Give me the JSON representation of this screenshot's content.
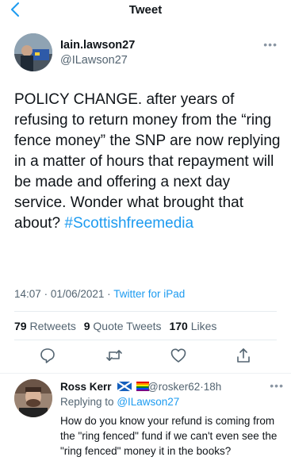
{
  "nav": {
    "title": "Tweet"
  },
  "tweet": {
    "author_name": "Iain.lawson27",
    "author_handle": "@ILawson27",
    "text": "POLICY CHANGE. after years of refusing to return money from the “ring fence money” the SNP are now replying in a matter of hours that repayment will be made and offering a next day service. Wonder what brought that about?",
    "hashtag": "#Scottishfreemedia",
    "time": "14:07",
    "date": "01/06/2021",
    "separator": "·",
    "source": "Twitter for iPad",
    "stats": {
      "retweets": "79",
      "retweets_label": "Retweets",
      "quote_tweets": "9",
      "quote_tweets_label": "Quote Tweets",
      "likes": "170",
      "likes_label": "Likes"
    }
  },
  "actions": [
    "reply-icon",
    "retweet-icon",
    "like-icon",
    "share-icon"
  ],
  "reply": {
    "author_name": "Ross Kerr",
    "author_handle": "@rosker62",
    "separator": "·",
    "age": "18h",
    "replying_label": "Replying to",
    "replying_to": "@ILawson27",
    "text": "How do you know your refund is coming from the \"ring fenced\" fund if we can't even see the \"ring fenced\" money it in the books?"
  },
  "colors": {
    "accent": "#1d9bf0",
    "text": "#0f1419",
    "secondary": "#536471",
    "divider": "#e6ecf0"
  }
}
